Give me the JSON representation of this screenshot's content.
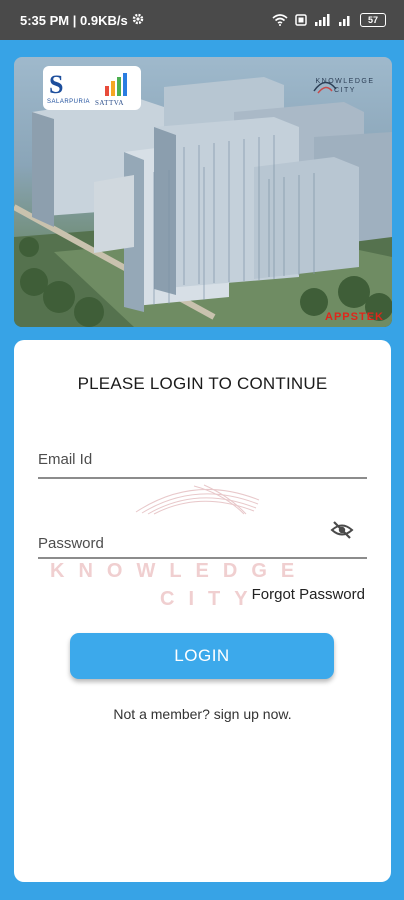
{
  "status_bar": {
    "time_speed": "5:35 PM | 0.9KB/s",
    "battery": "57"
  },
  "hero": {
    "brand_logo_letter": "S",
    "brand_name": "SALARPURIA",
    "brand_partner": "SATTVA",
    "project_logo_line1": "KNOWLEDGE",
    "project_logo_line2": "CITY",
    "developer_tag": "APPSTEK"
  },
  "login": {
    "title": "PLEASE LOGIN TO CONTINUE",
    "email_placeholder": "Email Id",
    "password_placeholder": "Password",
    "forgot_password": "Forgot Password",
    "login_button": "LOGIN",
    "signup_prompt": "Not a member? sign up now.",
    "watermark_line1": "KNOWLEDGE",
    "watermark_line2": "CITY"
  }
}
